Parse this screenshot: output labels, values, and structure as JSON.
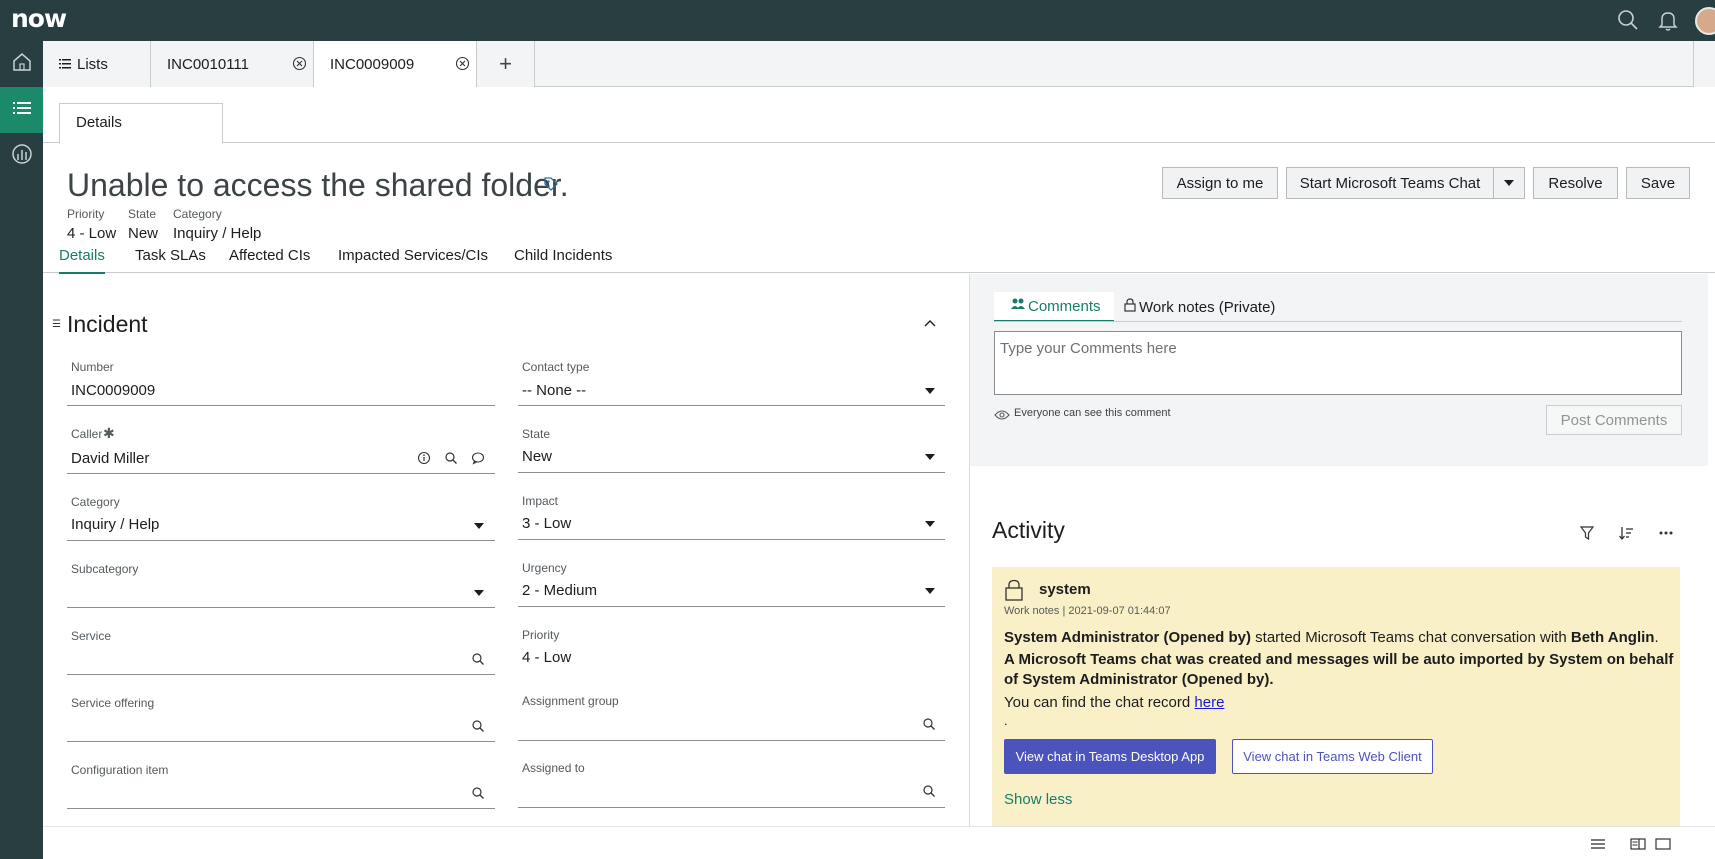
{
  "brand": {
    "logo": "now",
    "topbar_color": "#293e40",
    "accent": "#177d6a"
  },
  "top_icons": [
    "search-icon",
    "bell-icon",
    "user-avatar"
  ],
  "left_nav": [
    "home-icon",
    "list-icon",
    "analytics-icon"
  ],
  "tabs": {
    "lists": "Lists",
    "tab1": "INC0010111",
    "tab2": "INC0009009",
    "add": "+"
  },
  "subtab": "Details",
  "record": {
    "title": "Unable to access the shared folder.",
    "meta": [
      {
        "label": "Priority",
        "value": "4 - Low"
      },
      {
        "label": "State",
        "value": "New"
      },
      {
        "label": "Category",
        "value": "Inquiry / Help"
      }
    ]
  },
  "buttons": {
    "assign": "Assign to me",
    "teams": "Start Microsoft Teams Chat",
    "resolve": "Resolve",
    "save": "Save"
  },
  "form_tabs": [
    "Details",
    "Task SLAs",
    "Affected CIs",
    "Impacted Services/CIs",
    "Child Incidents"
  ],
  "section": "Incident",
  "fields": {
    "number": {
      "label": "Number",
      "value": "INC0009009"
    },
    "caller": {
      "label": "Caller",
      "value": "David Miller"
    },
    "category": {
      "label": "Category",
      "value": "Inquiry / Help"
    },
    "subcategory": {
      "label": "Subcategory",
      "value": ""
    },
    "service": {
      "label": "Service",
      "value": ""
    },
    "service_offering": {
      "label": "Service offering",
      "value": ""
    },
    "config_item": {
      "label": "Configuration item",
      "value": ""
    },
    "contact_type": {
      "label": "Contact type",
      "value": "-- None --"
    },
    "state": {
      "label": "State",
      "value": "New"
    },
    "impact": {
      "label": "Impact",
      "value": "3 - Low"
    },
    "urgency": {
      "label": "Urgency",
      "value": "2 - Medium"
    },
    "priority": {
      "label": "Priority",
      "value": "4 - Low"
    },
    "assignment_group": {
      "label": "Assignment group",
      "value": ""
    },
    "assigned_to": {
      "label": "Assigned to",
      "value": ""
    }
  },
  "comments": {
    "tab_comments": "Comments",
    "tab_worknotes": "Work notes (Private)",
    "placeholder": "Type your Comments here",
    "note": "Everyone can see this comment",
    "post": "Post Comments"
  },
  "activity": {
    "title": "Activity",
    "entry": {
      "author": "system",
      "type": "Work notes",
      "timestamp": "2021-09-07 01:44:07",
      "line1_bold1": "System Administrator (Opened by)",
      "line1_mid": " started Microsoft Teams chat conversation with ",
      "line1_bold2": "Beth Anglin",
      "line1_end": ".",
      "line2": "A Microsoft Teams chat was created and messages will be auto imported by System on behalf of System Administrator (Opened by).",
      "line3_text": "You can find the chat record ",
      "line3_link": "here",
      "dot": ".",
      "btn_desktop": "View chat in Teams Desktop App",
      "btn_web": "View chat in Teams Web Client",
      "show_less": "Show less"
    }
  }
}
